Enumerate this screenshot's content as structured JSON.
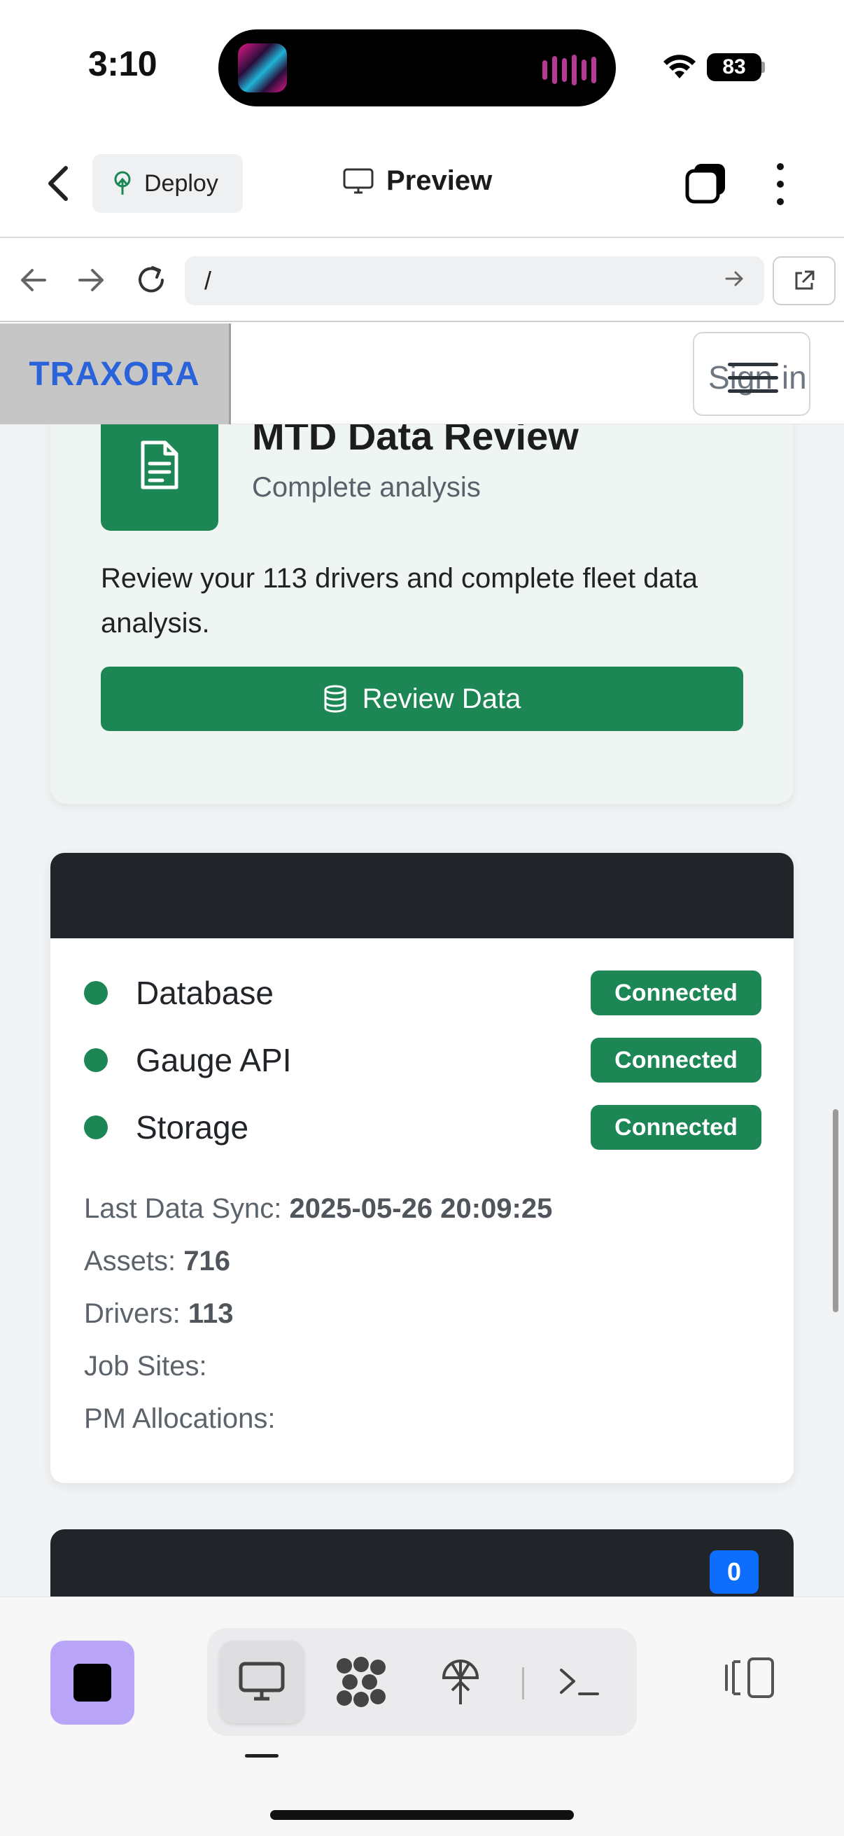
{
  "status_bar": {
    "time": "3:10",
    "battery": "83"
  },
  "topbar": {
    "deploy_label": "Deploy",
    "preview_label": "Preview"
  },
  "urlbar": {
    "url": "/"
  },
  "site_nav": {
    "brand": "TRAXORA",
    "signin": "Sign in"
  },
  "review_card": {
    "title": "MTD Data Review",
    "subtitle": "Complete analysis",
    "description": "Review your 113 drivers and complete fleet data analysis.",
    "button_label": "Review Data"
  },
  "status_card": {
    "services": [
      {
        "name": "Database",
        "status": "Connected"
      },
      {
        "name": "Gauge API",
        "status": "Connected"
      },
      {
        "name": "Storage",
        "status": "Connected"
      }
    ],
    "stats": {
      "sync_label": "Last Data Sync:",
      "sync_value": "2025-05-26 20:09:25",
      "assets_label": "Assets:",
      "assets_value": "716",
      "drivers_label": "Drivers:",
      "drivers_value": "113",
      "jobsites_label": "Job Sites:",
      "jobsites_value": "",
      "pm_label": "PM Allocations:",
      "pm_value": ""
    }
  },
  "next_card": {
    "count": "0"
  },
  "colors": {
    "success": "#1c8754",
    "brand": "#2962d9",
    "dark_header": "#212529",
    "primary_badge": "#0d6efd",
    "stop_button": "#b9a5f8"
  },
  "icons": [
    "back-chevron-icon",
    "deploy-icon",
    "monitor-icon",
    "tabs-icon",
    "more-icon",
    "arrow-left-icon",
    "arrow-right-icon",
    "reload-icon",
    "go-arrow-icon",
    "external-link-icon",
    "menu-icon",
    "document-icon",
    "database-icon",
    "stop-icon",
    "console-icon",
    "terminal-icon",
    "panel-icon"
  ]
}
